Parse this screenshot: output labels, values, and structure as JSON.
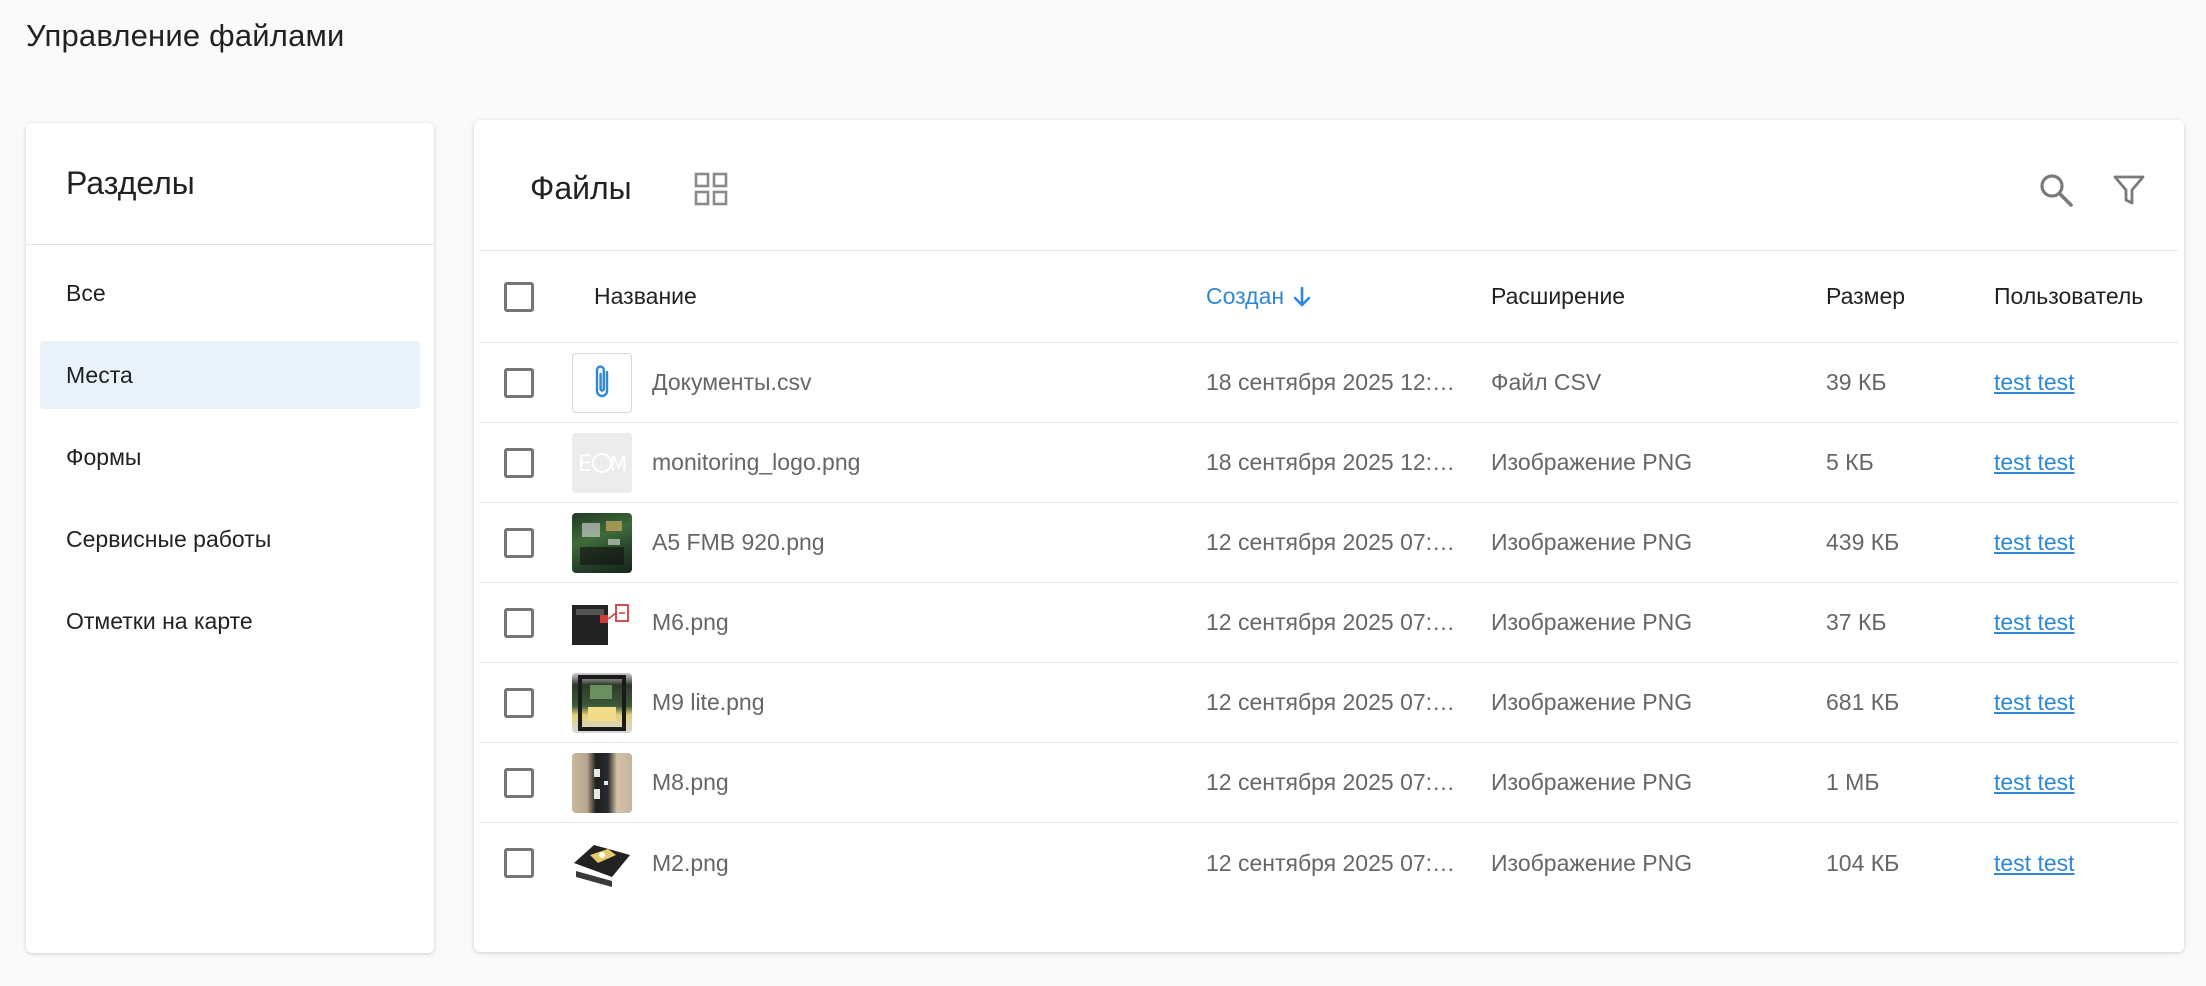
{
  "page": {
    "title": "Управление файлами"
  },
  "sidebar": {
    "title": "Разделы",
    "items": [
      {
        "label": "Все",
        "active": false
      },
      {
        "label": "Места",
        "active": true
      },
      {
        "label": "Формы",
        "active": false
      },
      {
        "label": "Сервисные работы",
        "active": false
      },
      {
        "label": "Отметки на карте",
        "active": false
      }
    ]
  },
  "main": {
    "title": "Файлы",
    "icons": {
      "view_toggle": "grid-view-icon",
      "search": "search-icon",
      "filter": "filter-icon"
    }
  },
  "table": {
    "columns": {
      "name": "Название",
      "created": "Создан",
      "extension": "Расширение",
      "size": "Размер",
      "user": "Пользователь"
    },
    "sort": {
      "column": "created",
      "direction": "desc"
    },
    "rows": [
      {
        "name": "Документы.csv",
        "created": "18 сентября 2025 12:…",
        "extension": "Файл CSV",
        "size": "39 КБ",
        "user": "test test",
        "thumb": "paperclip-icon"
      },
      {
        "name": "monitoring_logo.png",
        "created": "18 сентября 2025 12:…",
        "extension": "Изображение PNG",
        "size": "5 КБ",
        "user": "test test",
        "thumb": "logo-image"
      },
      {
        "name": "A5 FMB 920.png",
        "created": "12 сентября 2025 07:…",
        "extension": "Изображение PNG",
        "size": "439 КБ",
        "user": "test test",
        "thumb": "device-image"
      },
      {
        "name": "M6.png",
        "created": "12 сентября 2025 07:…",
        "extension": "Изображение PNG",
        "size": "37 КБ",
        "user": "test test",
        "thumb": "device-image"
      },
      {
        "name": "M9 lite.png",
        "created": "12 сентября 2025 07:…",
        "extension": "Изображение PNG",
        "size": "681 КБ",
        "user": "test test",
        "thumb": "device-image"
      },
      {
        "name": "M8.png",
        "created": "12 сентября 2025 07:…",
        "extension": "Изображение PNG",
        "size": "1 МБ",
        "user": "test test",
        "thumb": "device-image"
      },
      {
        "name": "M2.png",
        "created": "12 сентября 2025 07:…",
        "extension": "Изображение PNG",
        "size": "104 КБ",
        "user": "test test",
        "thumb": "device-image"
      }
    ]
  },
  "colors": {
    "accent": "#2f87d6",
    "active_item_bg": "#e9f1fa",
    "background": "#fafafa"
  }
}
